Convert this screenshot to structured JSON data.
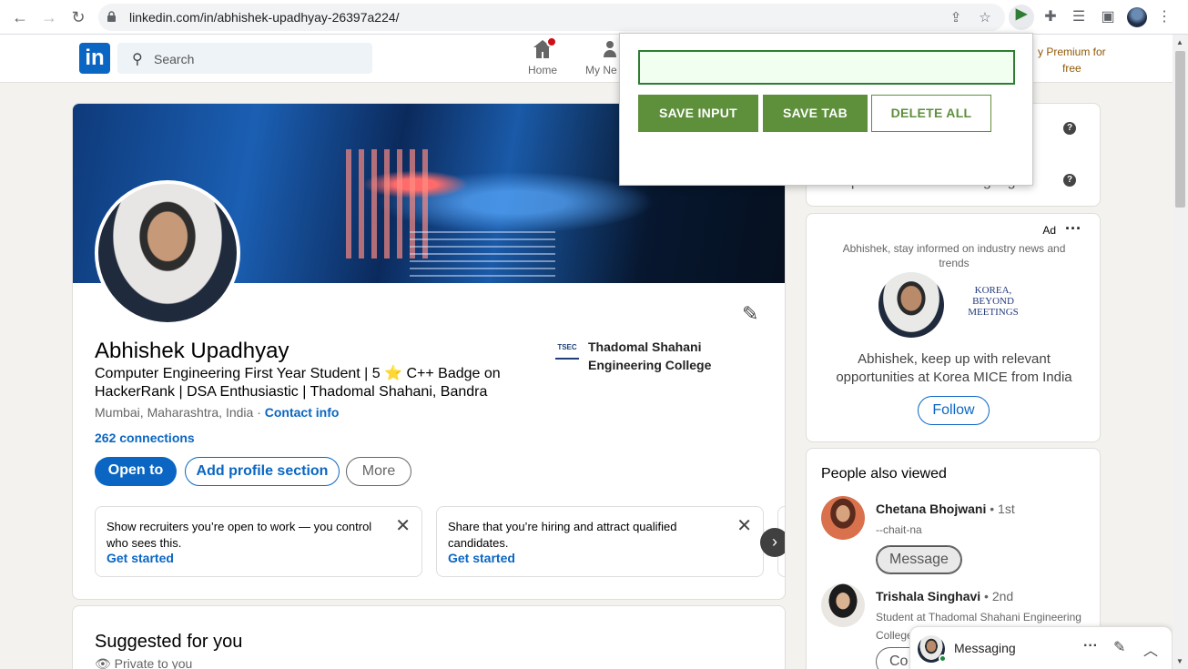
{
  "browser": {
    "url": "linkedin.com/in/abhishek-upadhyay-26397a224/",
    "icons": [
      "back-icon",
      "forward-icon",
      "reload-icon",
      "lock-icon",
      "share-icon",
      "bookmark-star-icon",
      "extension-active-icon",
      "puzzle-icon",
      "media-icon",
      "sidepanel-icon",
      "profile-avatar",
      "kebab-menu-icon"
    ]
  },
  "header": {
    "logo": "in",
    "search_placeholder": "Search",
    "nav": [
      {
        "label": "Home",
        "icon": "home-icon"
      },
      {
        "label": "My Ne",
        "icon": "network-icon"
      }
    ],
    "premium": [
      "y Premium for",
      "free"
    ]
  },
  "popup": {
    "input_value": "",
    "buttons": {
      "save_input": "SAVE INPUT",
      "save_tab": "SAVE TAB",
      "delete_all": "DELETE ALL"
    },
    "colors": {
      "accent": "#5e8f3b",
      "border": "#2e7d32"
    }
  },
  "profile": {
    "name": "Abhishek Upadhyay",
    "headline": "Computer Engineering First Year Student | 5 ⭐ C++ Badge on HackerRank | DSA Enthusiastic | Thadomal Shahani, Bandra",
    "location": "Mumbai, Maharashtra, India",
    "separator": " · ",
    "contact": "Contact info",
    "connections": "262 connections",
    "school_logo": "TSEC",
    "school": "Thadomal Shahani Engineering College",
    "buttons": {
      "open_to": "Open to",
      "add_section": "Add profile section",
      "more": "More"
    },
    "promos": [
      {
        "text_bold": "Show recruiters you’re open to work",
        "text_rest": " — you control who sees this.",
        "cta": "Get started"
      },
      {
        "text_bold": "Share that you’re hiring",
        "text_rest": " and attract qualified candidates.",
        "cta": "Get started"
      }
    ]
  },
  "suggested": {
    "title": "Suggested for you",
    "privacy": "Private to you"
  },
  "right_rail": {
    "language": "Add profile in another language",
    "ad": {
      "label": "Ad",
      "info": "Abhishek, stay informed on industry news and trends",
      "brand": [
        "KOREA,",
        "BEYOND",
        "MEETINGS"
      ],
      "message": "Abhishek, keep up with relevant opportunities at Korea MICE from India",
      "follow": "Follow"
    },
    "people_also_viewed": {
      "title": "People also viewed",
      "people": [
        {
          "name": "Chetana Bhojwani",
          "degree": "1st",
          "subtitle": "--chait-na",
          "button": "Message"
        },
        {
          "name": "Trishala Singhavi",
          "degree": "2nd",
          "subtitle": "Student at Thadomal Shahani Engineering College",
          "button": "Co"
        }
      ]
    }
  },
  "messaging": {
    "label": "Messaging"
  },
  "colors": {
    "linkedin_blue": "#0a66c2",
    "page_bg": "#f3f2ef"
  }
}
